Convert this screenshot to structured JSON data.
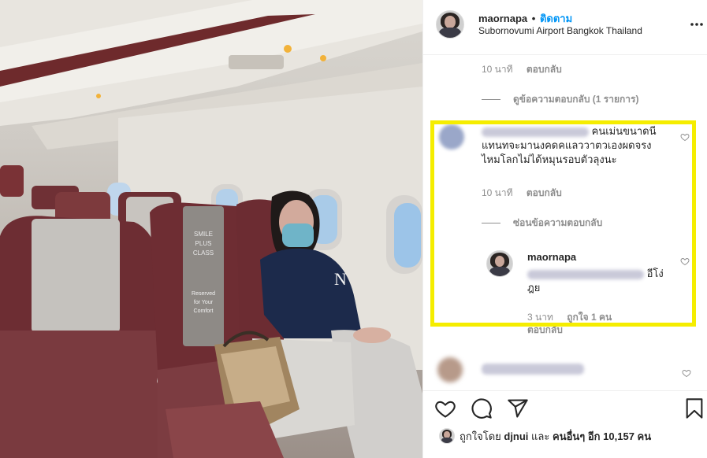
{
  "post": {
    "username": "maornapa",
    "separator": "•",
    "follow_label": "ติดตาม",
    "location": "Subornovumi Airport Bangkok Thailand"
  },
  "comments": {
    "c1_time": "10 นาที",
    "c1_reply": "ตอบกลับ",
    "c1_view_replies": "ดูข้อความตอบกลับ (1 รายการ)",
    "c2_text_line1": "คนเม่นขนาดนี",
    "c2_text_line2": "แทนทจะมานงคดคแลววาตวเองผดจรง",
    "c2_text_line3": "ไหมโลกไม่ได้หมุนรอบตัวลุงนะ",
    "c2_time": "10 นาที",
    "c2_reply": "ตอบกลับ",
    "c2_hide_replies": "ซ่อนข้อความตอบกลับ",
    "reply_username": "maornapa",
    "reply_text_end": "อีโง่",
    "reply_text_line2": "ฎย",
    "reply_time": "3 นาท",
    "reply_likes": "ถูกใจ 1 คน",
    "reply_reply": "ตอบกลับ"
  },
  "likes": {
    "prefix": "ถูกใจโดย",
    "user": "djnui",
    "and": "และ",
    "others": "คนอื่นๆ อีก 10,157 คน"
  },
  "icons": {
    "more": "more-icon",
    "heart": "heart-icon",
    "comment": "comment-icon",
    "share": "share-icon",
    "bookmark": "bookmark-icon"
  },
  "colors": {
    "follow": "#0095f6",
    "highlight": "#f5ed00",
    "muted": "#8e8e8e"
  }
}
